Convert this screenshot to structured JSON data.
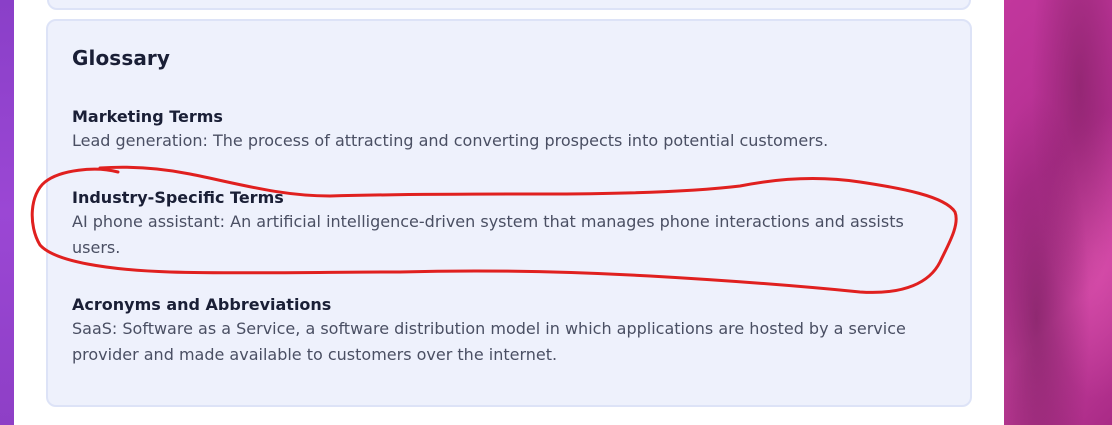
{
  "glossary": {
    "title": "Glossary",
    "sections": [
      {
        "heading": "Marketing Terms",
        "body": "Lead generation: The process of attracting and converting prospects into potential customers."
      },
      {
        "heading": "Industry-Specific Terms",
        "body": "AI phone assistant: An artificial intelligence-driven system that manages phone interactions and assists users."
      },
      {
        "heading": "Acronyms and Abbreviations",
        "body": "SaaS: Software as a Service, a software distribution model in which applications are hosted by a service provider and made available to customers over the internet."
      }
    ]
  },
  "annotation": {
    "color": "#e0201f"
  },
  "colors": {
    "card_bg": "#eef1fc",
    "card_border": "#dde3f7",
    "heading": "#1a1f36",
    "body_text": "#4a4f63",
    "left_bg": "#9b47d4",
    "right_bg": "#c2379d"
  }
}
